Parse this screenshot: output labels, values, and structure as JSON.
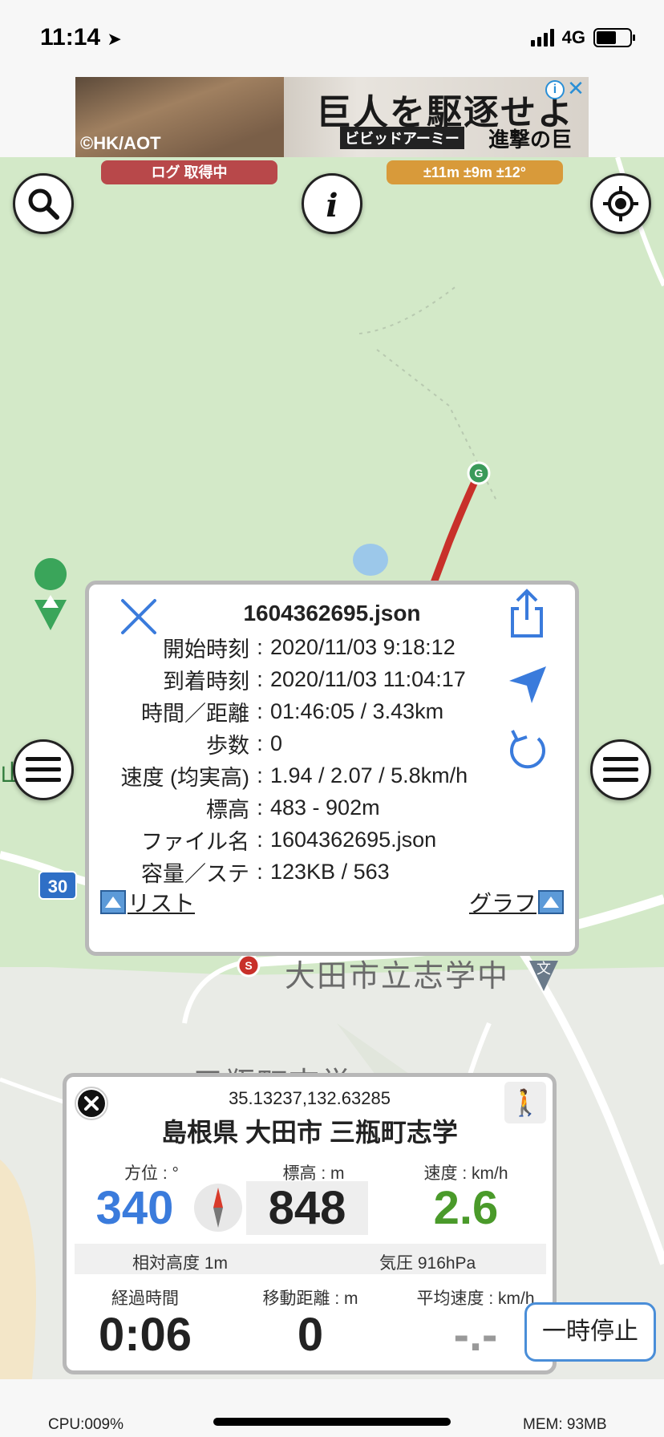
{
  "status_bar": {
    "time": "11:14",
    "network": "4G"
  },
  "ad": {
    "title": "巨人を駆逐せよ",
    "subtitle": "ビビッドアーミー",
    "subtitle2": "進撃の巨人",
    "copyright": "©HK/AOT",
    "info_glyph": "i",
    "close_glyph": "✕"
  },
  "status_pills": {
    "log": "ログ 取得中",
    "accuracy": "±11m ±9m ±12°"
  },
  "map": {
    "road_number": "30",
    "school_label": "大田市立志学中",
    "town_label": "三瓶町志学",
    "mountain_label": "山"
  },
  "track_popup": {
    "title": "1604362695.json",
    "rows": [
      {
        "key": "開始時刻",
        "value": "2020/11/03 9:18:12"
      },
      {
        "key": "到着時刻",
        "value": "2020/11/03 11:04:17"
      },
      {
        "key": "時間／距離",
        "value": "01:46:05 / 3.43km"
      },
      {
        "key": "歩数",
        "value": "0"
      },
      {
        "key": "速度 (均実高)",
        "value": "1.94 / 2.07 / 5.8km/h"
      },
      {
        "key": "標高",
        "value": "483 - 902m"
      },
      {
        "key": "ファイル名",
        "value": "1604362695.json"
      },
      {
        "key": "容量／ステ",
        "value": "123KB / 563"
      }
    ],
    "separator": ":",
    "list_label": "リスト",
    "graph_label": "グラフ"
  },
  "info_card": {
    "coords": "35.13237,132.63285",
    "address": "島根県 大田市 三瓶町志学",
    "heading_label": "方位 : °",
    "heading_value": "340",
    "altitude_label": "標高 : m",
    "altitude_value": "848",
    "speed_label": "速度 : km/h",
    "speed_value": "2.6",
    "relative_altitude": "相対高度 1m",
    "pressure": "気圧 916hPa",
    "elapsed_label": "経過時間",
    "elapsed_value": "0:06",
    "distance_label": "移動距離 : m",
    "distance_value": "0",
    "avg_speed_label": "平均速度 : km/h",
    "avg_speed_value": "-.-"
  },
  "pause_button": "一時停止",
  "footer": {
    "cpu": "CPU:009%",
    "mem": "MEM: 93MB"
  },
  "colors": {
    "heading": "#3a7bdc",
    "speed": "#4a9a2a",
    "track": "#c8302a",
    "accent": "#3a7bdc"
  }
}
